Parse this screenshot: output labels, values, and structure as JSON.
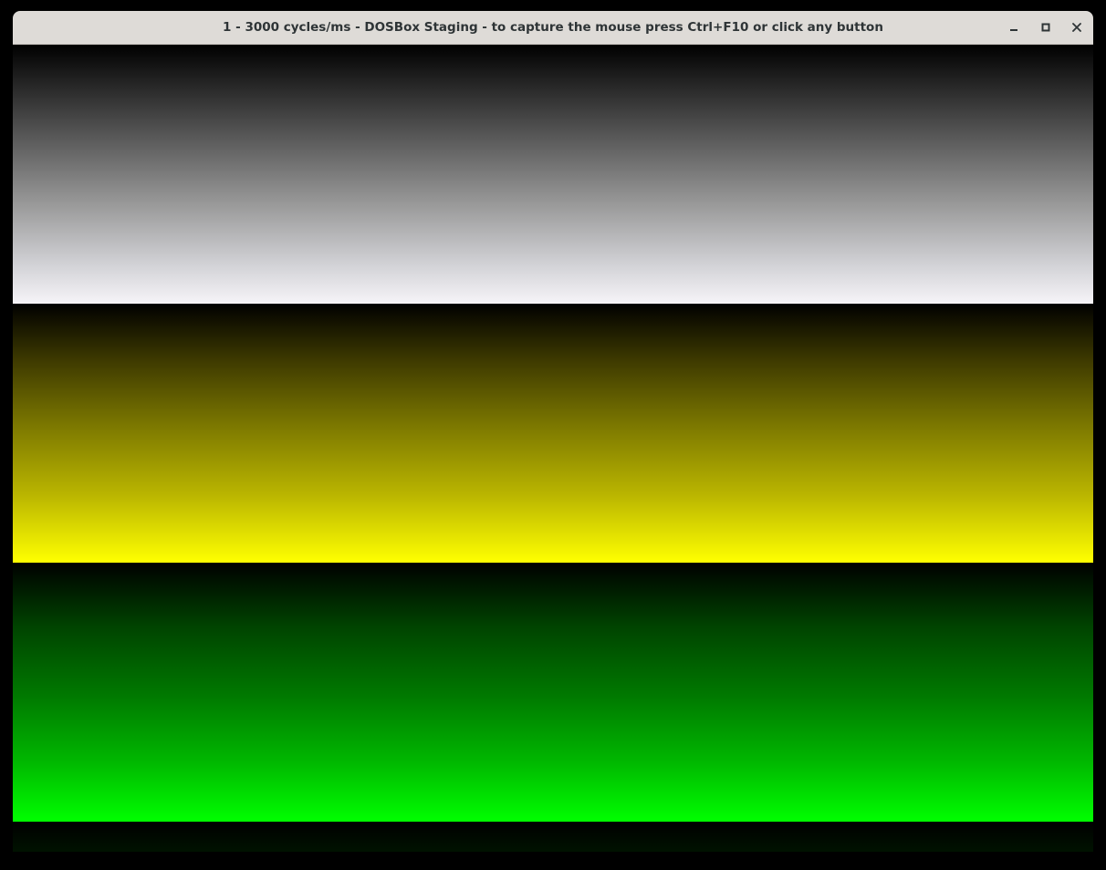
{
  "window": {
    "title": "1 - 3000 cycles/ms - DOSBox Staging - to capture the mouse press Ctrl+F10 or click any button",
    "controls": {
      "minimize_icon": "minimize-icon",
      "maximize_icon": "maximize-icon",
      "close_icon": "close-icon"
    },
    "titlebar_color": "#dedbd7"
  },
  "screen": {
    "bands": [
      {
        "color_start": "#000000",
        "color_end": "#f6f4f8",
        "name": "grey-gradient"
      },
      {
        "color_start": "#000000",
        "color_end": "#ffff00",
        "name": "yellow-gradient"
      },
      {
        "color_start": "#000000",
        "color_end": "#00ff00",
        "name": "green-gradient"
      }
    ]
  }
}
